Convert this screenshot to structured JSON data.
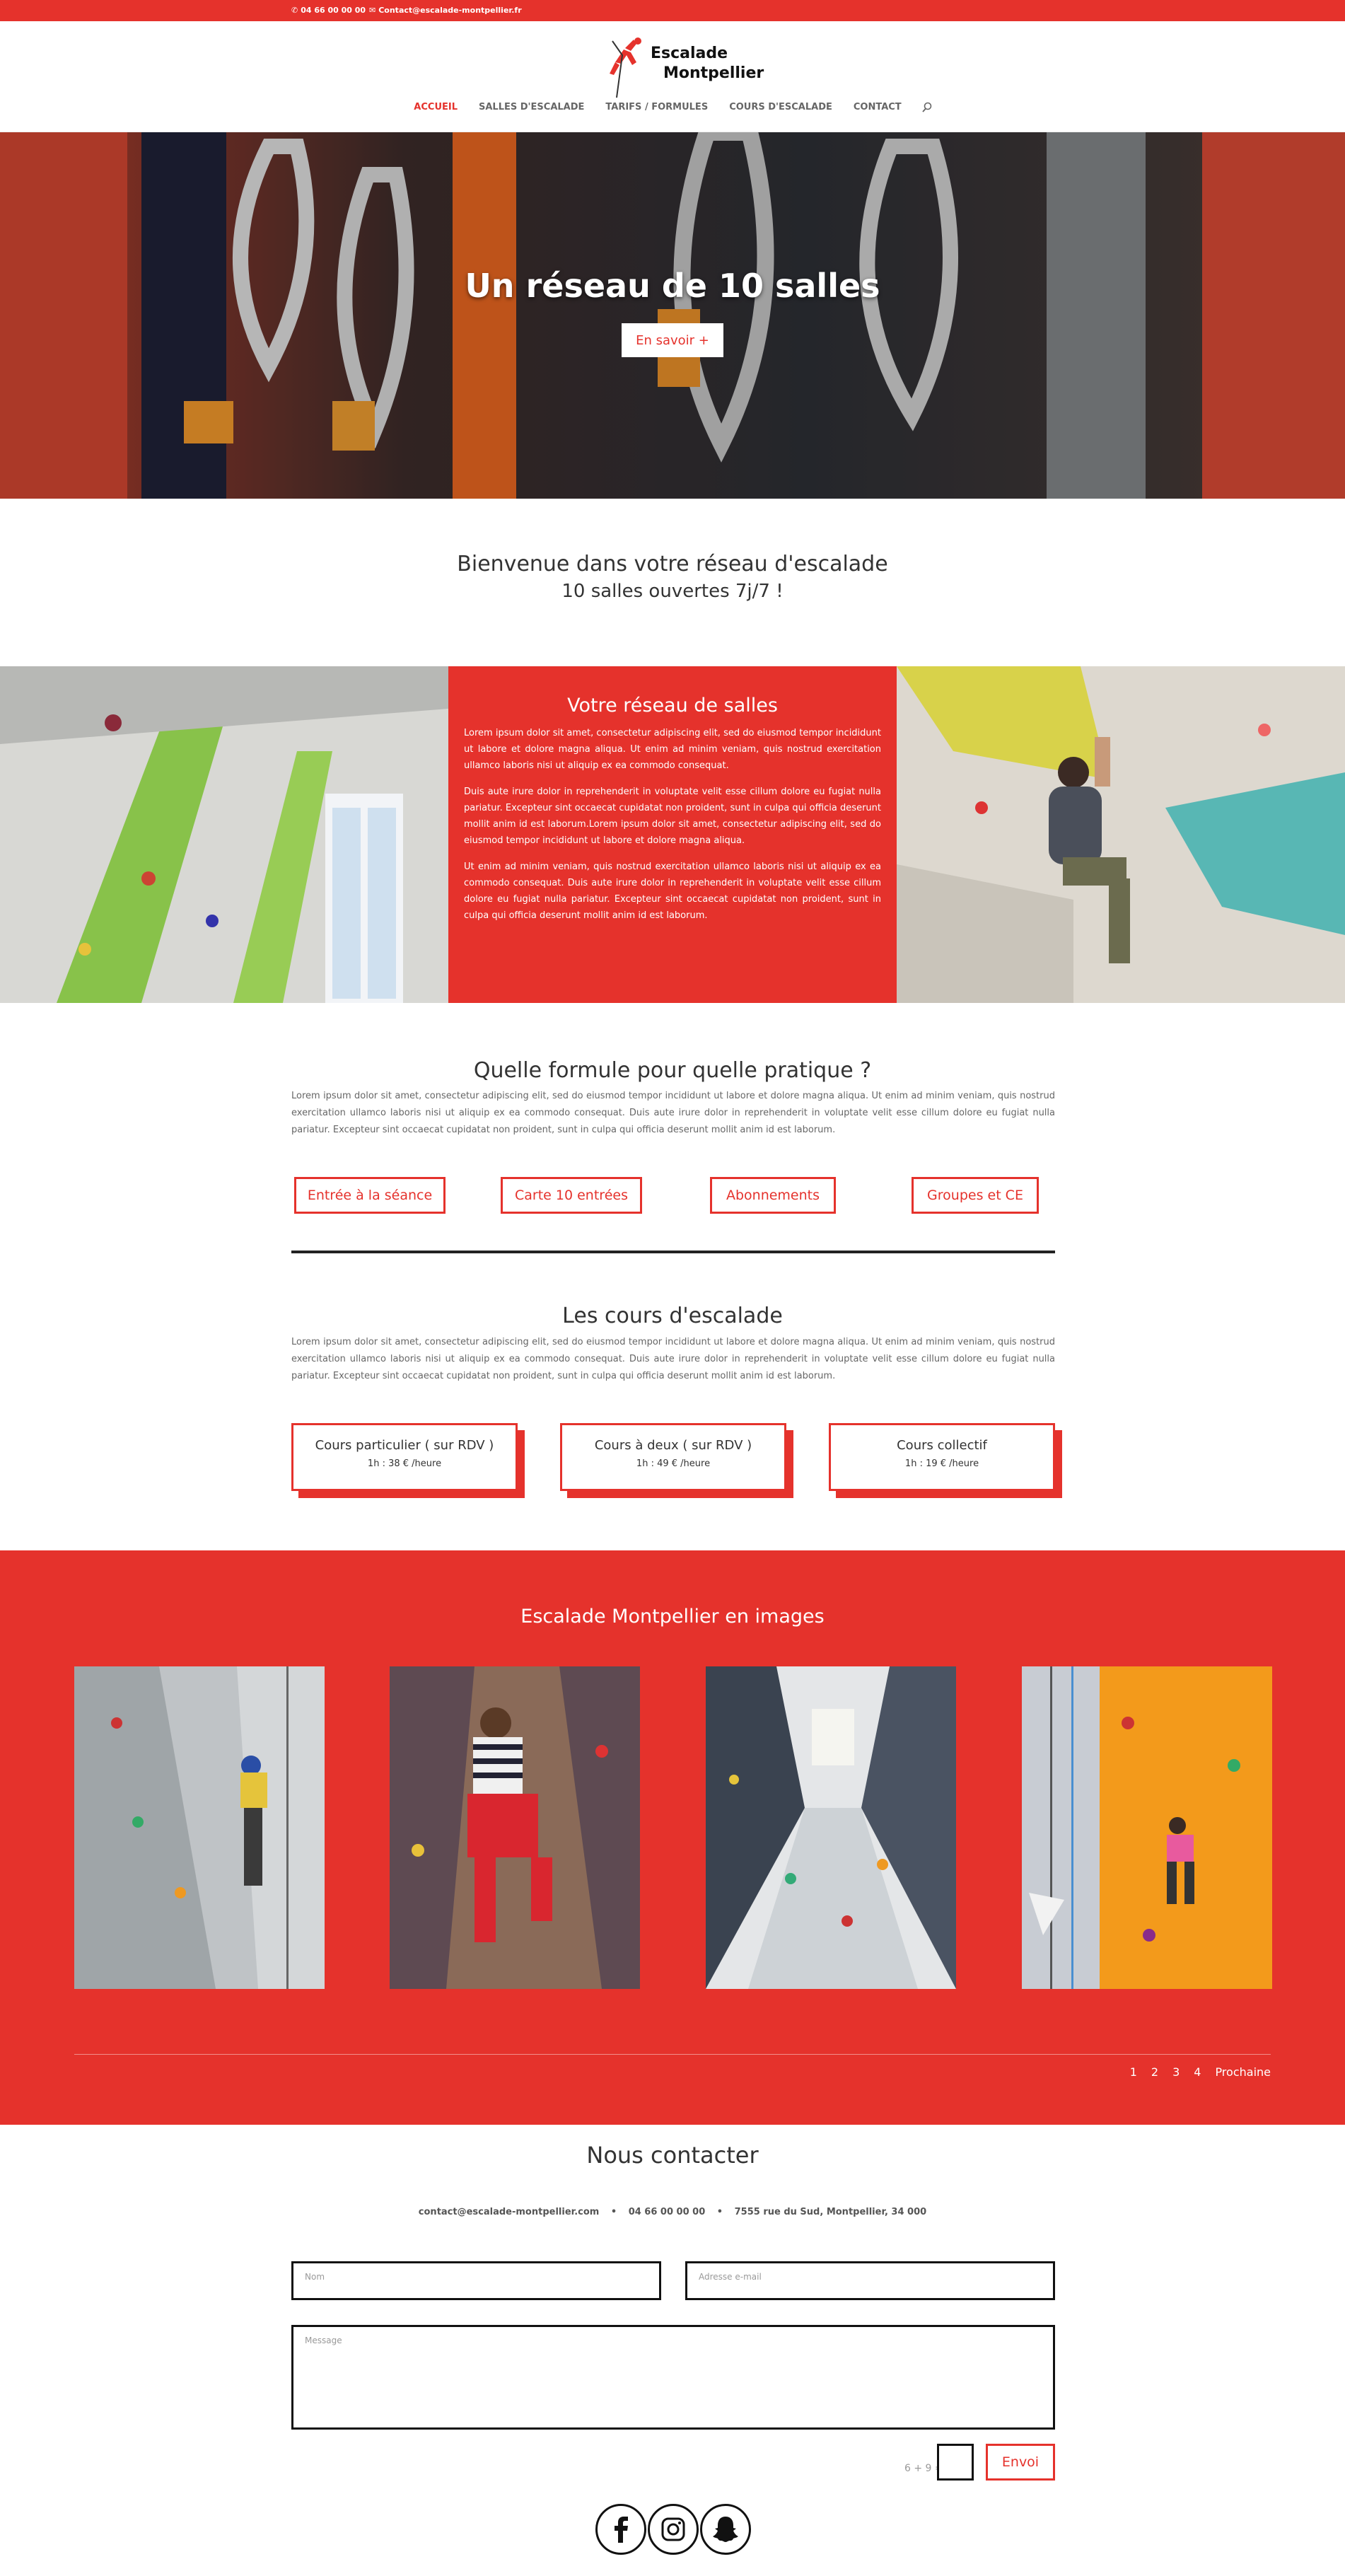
{
  "topbar": {
    "phone": "04 66 00 00 00",
    "email": "Contact@escalade-montpellier.fr"
  },
  "logo": {
    "line1": "Escalade",
    "line2": "Montpellier"
  },
  "nav": {
    "items": [
      "ACCUEIL",
      "SALLES D'ESCALADE",
      "TARIFS / FORMULES",
      "COURS D'ESCALADE",
      "CONTACT"
    ],
    "active": "ACCUEIL"
  },
  "hero": {
    "title": "Un réseau de 10 salles",
    "button": "En savoir +"
  },
  "welcome": {
    "title": "Bienvenue dans votre réseau d'escalade",
    "subtitle": "10 salles ouvertes 7j/7 !"
  },
  "network": {
    "title": "Votre réseau de salles",
    "paragraphs": [
      "Lorem ipsum dolor sit amet, consectetur adipiscing elit, sed do eiusmod tempor incididunt ut labore et dolore magna aliqua. Ut enim ad minim veniam, quis nostrud exercitation ullamco laboris nisi ut aliquip ex ea commodo consequat.",
      "Duis aute irure dolor in reprehenderit in voluptate velit esse cillum dolore eu fugiat nulla pariatur. Excepteur sint occaecat cupidatat non proident, sunt in culpa qui officia deserunt mollit anim id est laborum.Lorem ipsum dolor sit amet, consectetur adipiscing elit, sed do eiusmod tempor incididunt ut labore et dolore magna aliqua.",
      "Ut enim ad minim veniam, quis nostrud exercitation ullamco laboris nisi ut aliquip ex ea commodo consequat. Duis aute irure dolor in reprehenderit in voluptate velit esse cillum dolore eu fugiat nulla pariatur. Excepteur sint occaecat cupidatat non proident, sunt in culpa qui officia deserunt mollit anim id est laborum."
    ]
  },
  "formules": {
    "title": "Quelle formule pour quelle pratique ?",
    "text": "Lorem ipsum dolor sit amet, consectetur adipiscing elit, sed do eiusmod tempor incididunt ut labore et dolore magna aliqua. Ut enim ad minim veniam, quis nostrud exercitation ullamco laboris nisi ut aliquip ex ea commodo consequat. Duis aute irure dolor in reprehenderit in voluptate velit esse cillum dolore eu fugiat nulla pariatur. Excepteur sint occaecat cupidatat non proident, sunt in culpa qui officia deserunt mollit anim id est laborum.",
    "buttons": [
      "Entrée à la séance",
      "Carte 10 entrées",
      "Abonnements",
      "Groupes et CE"
    ]
  },
  "cours": {
    "title": "Les cours d'escalade",
    "text": "Lorem ipsum dolor sit amet, consectetur adipiscing elit, sed do eiusmod tempor incididunt ut labore et dolore magna aliqua. Ut enim ad minim veniam, quis nostrud exercitation ullamco laboris nisi ut aliquip ex ea commodo consequat. Duis aute irure dolor in reprehenderit in voluptate velit esse cillum dolore eu fugiat nulla pariatur. Excepteur sint occaecat cupidatat non proident, sunt in culpa qui officia deserunt mollit anim id est laborum.",
    "cards": [
      {
        "title": "Cours particulier ( sur RDV )",
        "price": "1h : 38 € /heure"
      },
      {
        "title": "Cours à deux ( sur RDV )",
        "price": "1h : 49 € /heure"
      },
      {
        "title": "Cours collectif",
        "price": "1h : 19 € /heure"
      }
    ]
  },
  "gallery": {
    "title": "Escalade Montpellier en images",
    "pages": [
      "1",
      "2",
      "3",
      "4"
    ],
    "next": "Prochaine"
  },
  "contact": {
    "title": "Nous contacter",
    "email": "contact@escalade-montpellier.com",
    "phone": "04 66 00 00 00",
    "address": "7555 rue du Sud, Montpellier, 34 000",
    "name_placeholder": "Nom",
    "email_placeholder": "Adresse e-mail",
    "message_placeholder": "Message",
    "captcha": "6 + 9 =",
    "send": "Envoi"
  },
  "colors": {
    "brand_red": "#e5322c",
    "text_dark": "#333333"
  },
  "icons": [
    "phone-icon",
    "mail-icon",
    "search-icon",
    "facebook-icon",
    "instagram-icon",
    "snapchat-icon"
  ]
}
